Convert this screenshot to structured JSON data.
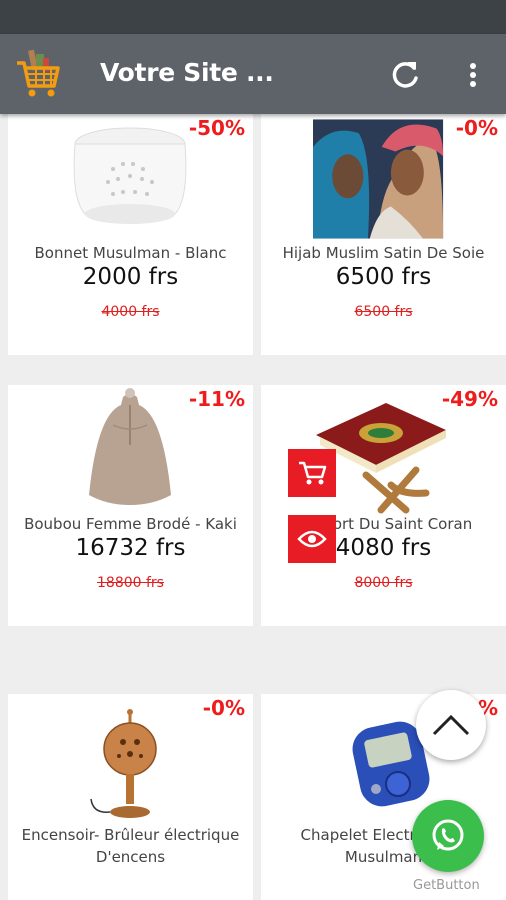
{
  "app": {
    "title": "Votre Site ...",
    "logo_icon": "shopping-cart-icon",
    "refresh_icon": "refresh-icon",
    "menu_icon": "more-vertical-icon"
  },
  "colors": {
    "appbar": "#5d6368",
    "statusbar": "#3d4246",
    "accent": "#e81c24",
    "discount": "#ee1c1c",
    "whatsapp": "#3bbe4b",
    "logo": "#f39c12"
  },
  "products": [
    {
      "name": "Bonnet Musulman - Blanc",
      "price": "2000 frs",
      "old_price": "4000 frs",
      "discount": "-50%",
      "image_icon": "white-kufi-cap"
    },
    {
      "name": "Hijab Muslim Satin De Soie",
      "price": "6500 frs",
      "old_price": "6500 frs",
      "discount": "-0%",
      "image_icon": "hijab-photo"
    },
    {
      "name": "Boubou Femme Brodé - Kaki",
      "price": "16732 frs",
      "old_price": "18800 frs",
      "discount": "-11%",
      "image_icon": "boubou-dress"
    },
    {
      "name": "Support Du Saint Coran",
      "price": "4080 frs",
      "old_price": "8000 frs",
      "discount": "-49%",
      "image_icon": "quran-stand"
    },
    {
      "name": "Encensoir- Brûleur électrique D'encens",
      "price": "",
      "old_price": "",
      "discount": "-0%",
      "image_icon": "incense-burner"
    },
    {
      "name": "Chapelet Electronique Musulman",
      "price": "",
      "old_price": "",
      "discount": "-0%",
      "image_icon": "digital-tally-counter"
    }
  ],
  "quick_actions": {
    "cart_icon": "add-to-cart-icon",
    "view_icon": "eye-icon"
  },
  "floating": {
    "scroll_top_icon": "chevron-up-icon",
    "whatsapp_icon": "whatsapp-icon",
    "getbutton_label": "GetButton"
  }
}
